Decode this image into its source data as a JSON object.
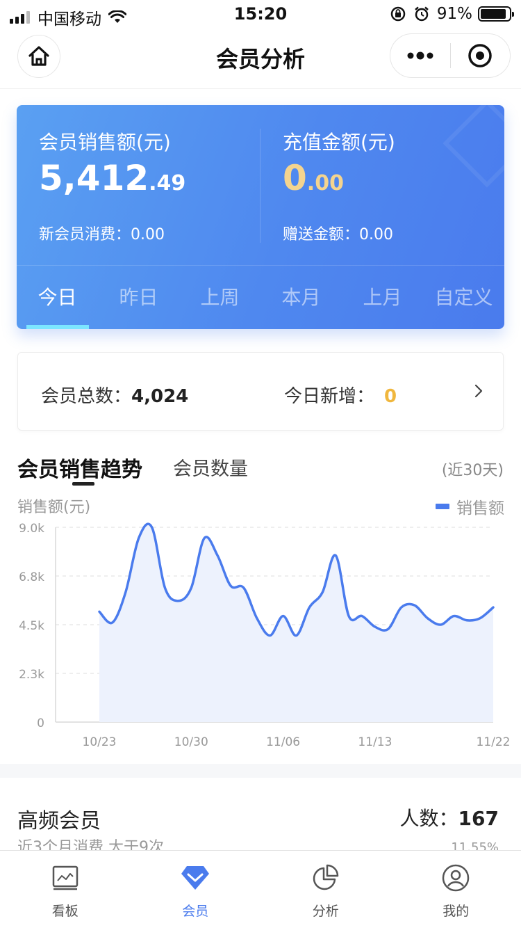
{
  "status_bar": {
    "carrier": "中国移动",
    "time": "15:20",
    "battery": "91%",
    "battery_level": 0.91
  },
  "nav": {
    "title": "会员分析"
  },
  "sales_card": {
    "member_sales_label": "会员销售额(元)",
    "member_sales_int": "5,412",
    "member_sales_dec": ".49",
    "new_member_label": "新会员消费：",
    "new_member_value": "0.00",
    "recharge_label": "充值金额(元)",
    "recharge_int": "0",
    "recharge_dec": ".00",
    "gift_label": "赠送金额：",
    "gift_value": "0.00",
    "accent_color": "#4f88ef",
    "gold_color": "#f4d48f"
  },
  "period_tabs": [
    {
      "label": "今日",
      "active": true
    },
    {
      "label": "昨日",
      "active": false
    },
    {
      "label": "上周",
      "active": false
    },
    {
      "label": "本月",
      "active": false
    },
    {
      "label": "上月",
      "active": false
    },
    {
      "label": "自定义",
      "active": false
    }
  ],
  "summary": {
    "total_label": "会员总数：",
    "total_value": "4,024",
    "new_today_label": "今日新增：",
    "new_today_value": "0"
  },
  "trend": {
    "tab_sales": "会员销售趋势",
    "tab_count": "会员数量",
    "period": "(近30天)"
  },
  "chart_data": {
    "type": "area",
    "ylabel": "销售额(元)",
    "series": [
      {
        "name": "销售额",
        "color": "#4a7bed",
        "points": [
          [
            "10/23",
            5100
          ],
          [
            "10/24",
            4600
          ],
          [
            "10/25",
            6000
          ],
          [
            "10/26",
            8500
          ],
          [
            "10/27",
            9000
          ],
          [
            "10/28",
            6200
          ],
          [
            "10/29",
            5600
          ],
          [
            "10/30",
            6200
          ],
          [
            "10/31",
            8500
          ],
          [
            "11/01",
            7700
          ],
          [
            "11/02",
            6300
          ],
          [
            "11/03",
            6200
          ],
          [
            "11/04",
            4800
          ],
          [
            "11/05",
            4000
          ],
          [
            "11/06",
            4900
          ],
          [
            "11/07",
            4000
          ],
          [
            "11/08",
            5300
          ],
          [
            "11/09",
            6000
          ],
          [
            "11/10",
            7700
          ],
          [
            "11/11",
            4900
          ],
          [
            "11/12",
            4900
          ],
          [
            "11/13",
            4400
          ],
          [
            "11/14",
            4300
          ],
          [
            "11/15",
            5300
          ],
          [
            "11/16",
            5400
          ],
          [
            "11/17",
            4800
          ],
          [
            "11/18",
            4500
          ],
          [
            "11/19",
            4900
          ],
          [
            "11/20",
            4700
          ],
          [
            "11/21",
            4800
          ],
          [
            "11/22",
            5300
          ]
        ]
      }
    ],
    "yticks": [
      {
        "label": "9.0k",
        "value": 9000
      },
      {
        "label": "6.8k",
        "value": 6750
      },
      {
        "label": "4.5k",
        "value": 4500
      },
      {
        "label": "2.3k",
        "value": 2250
      },
      {
        "label": "0",
        "value": 0
      }
    ],
    "xticks": [
      "10/23",
      "10/30",
      "11/06",
      "11/13",
      "11/22"
    ],
    "ylim": [
      0,
      9000
    ],
    "grid": true,
    "legend_position": "top-right"
  },
  "high_freq": {
    "title": "高频会员",
    "count_label": "人数：",
    "count_value": "167",
    "desc": "近3个月消费 大于9次",
    "percent": "11.55%"
  },
  "tab_bar": [
    {
      "label": "看板",
      "icon": "dashboard-icon",
      "active": false
    },
    {
      "label": "会员",
      "icon": "member-icon",
      "active": true
    },
    {
      "label": "分析",
      "icon": "pie-chart-icon",
      "active": false
    },
    {
      "label": "我的",
      "icon": "profile-icon",
      "active": false
    }
  ]
}
